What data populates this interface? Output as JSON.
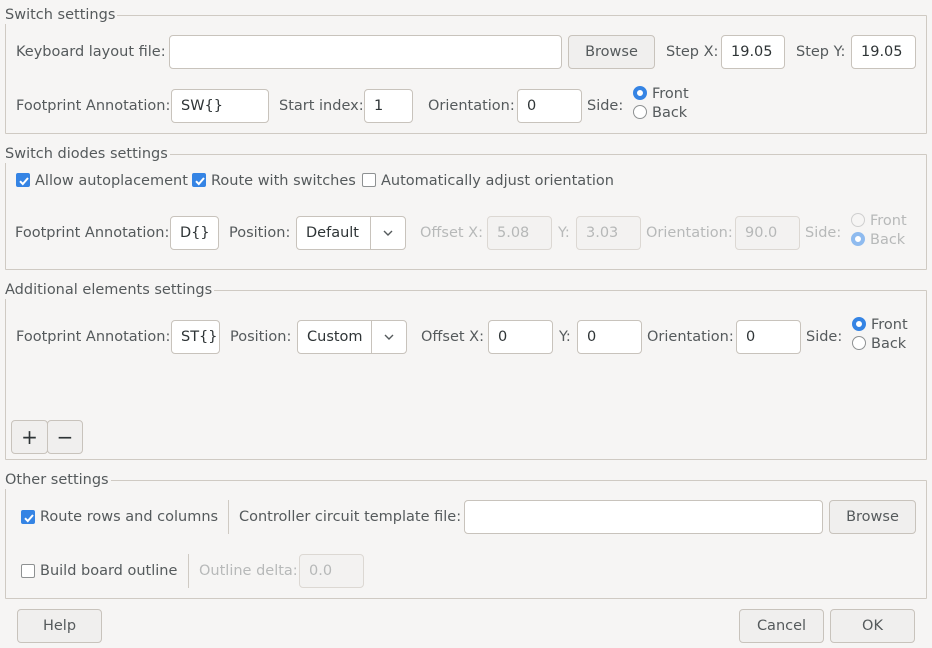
{
  "switch": {
    "title": "Switch settings",
    "layout_label": "Keyboard layout file:",
    "layout_value": "",
    "browse": "Browse",
    "stepx_label": "Step X:",
    "stepx": "19.05",
    "stepy_label": "Step Y:",
    "stepy": "19.05",
    "fp_label": "Footprint Annotation:",
    "fp": "SW{}",
    "start_label": "Start index:",
    "start": "1",
    "orient_label": "Orientation:",
    "orient": "0",
    "side_label": "Side:",
    "front": "Front",
    "back": "Back",
    "side_selected": "Front"
  },
  "diodes": {
    "title": "Switch diodes settings",
    "auto_place": "Allow autoplacement",
    "auto_place_checked": true,
    "route": "Route with switches",
    "route_checked": true,
    "adjust": "Automatically adjust orientation",
    "adjust_checked": false,
    "fp_label": "Footprint Annotation:",
    "fp": "D{}",
    "pos_label": "Position:",
    "pos": "Default",
    "offx_label": "Offset X:",
    "offx": "5.08",
    "y_label": "Y:",
    "y": "3.03",
    "orient_label": "Orientation:",
    "orient": "90.0",
    "side_label": "Side:",
    "front": "Front",
    "back": "Back",
    "side_selected": "Back"
  },
  "additional": {
    "title": "Additional elements settings",
    "fp_label": "Footprint Annotation:",
    "fp": "ST{}",
    "pos_label": "Position:",
    "pos": "Custom",
    "offx_label": "Offset X:",
    "offx": "0",
    "y_label": "Y:",
    "y": "0",
    "orient_label": "Orientation:",
    "orient": "0",
    "side_label": "Side:",
    "front": "Front",
    "back": "Back",
    "side_selected": "Front",
    "add": "+",
    "remove": "−"
  },
  "other": {
    "title": "Other settings",
    "route_rc": "Route rows and columns",
    "route_rc_checked": true,
    "template_label": "Controller circuit template file:",
    "template_value": "",
    "browse": "Browse",
    "outline": "Build board outline",
    "outline_checked": false,
    "delta_label": "Outline delta:",
    "delta": "0.0"
  },
  "footer": {
    "help": "Help",
    "cancel": "Cancel",
    "ok": "OK"
  },
  "colors": {
    "accent": "#3584e4"
  }
}
